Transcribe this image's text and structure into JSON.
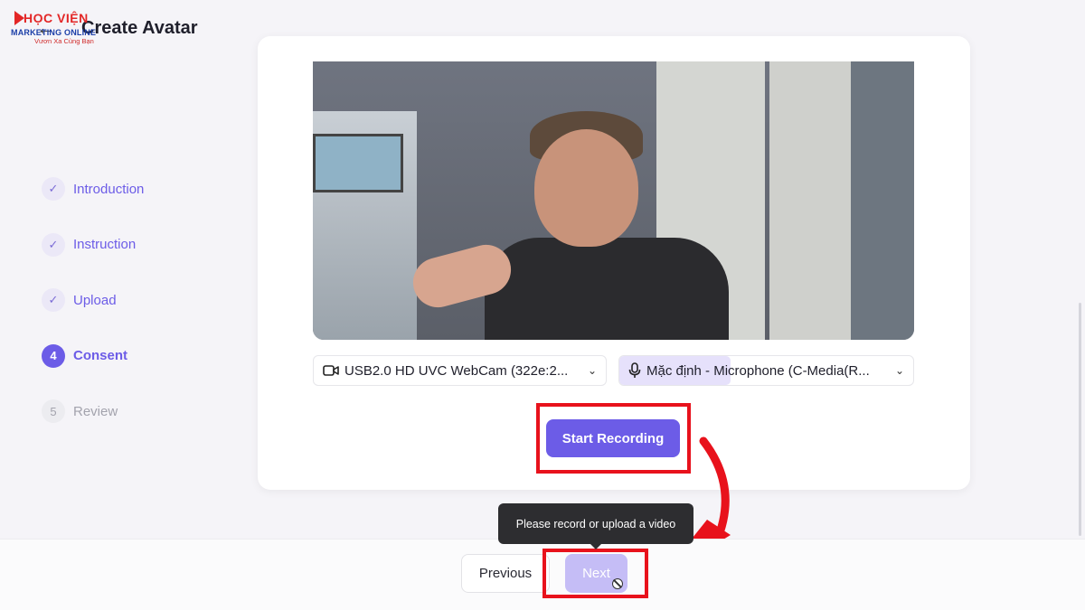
{
  "watermark": {
    "brand_top": "HỌC VIỆN",
    "brand_mid": "MARKETING ONLINE",
    "brand_sub": "Vươn Xa Cùng Bạn"
  },
  "header": {
    "title": "Create Avatar",
    "back_icon": "arrow-left-icon"
  },
  "stepper": {
    "steps": [
      {
        "marker": "✓",
        "label": "Introduction",
        "state": "done"
      },
      {
        "marker": "✓",
        "label": "Instruction",
        "state": "done"
      },
      {
        "marker": "✓",
        "label": "Upload",
        "state": "done"
      },
      {
        "marker": "4",
        "label": "Consent",
        "state": "active"
      },
      {
        "marker": "5",
        "label": "Review",
        "state": "todo"
      }
    ]
  },
  "devices": {
    "camera": {
      "icon": "video-camera-icon",
      "label": "USB2.0 HD UVC WebCam (322e:2..."
    },
    "microphone": {
      "icon": "microphone-icon",
      "label": "Mặc định - Microphone (C-Media(R..."
    }
  },
  "recording": {
    "button_label": "Start Recording"
  },
  "tooltip": {
    "text": "Please record or upload a video"
  },
  "footer": {
    "previous_label": "Previous",
    "next_label": "Next",
    "next_disabled": true
  },
  "colors": {
    "accent": "#6c5ce7",
    "disabled_accent": "#c5bdf6",
    "annotation_red": "#e8121c"
  }
}
